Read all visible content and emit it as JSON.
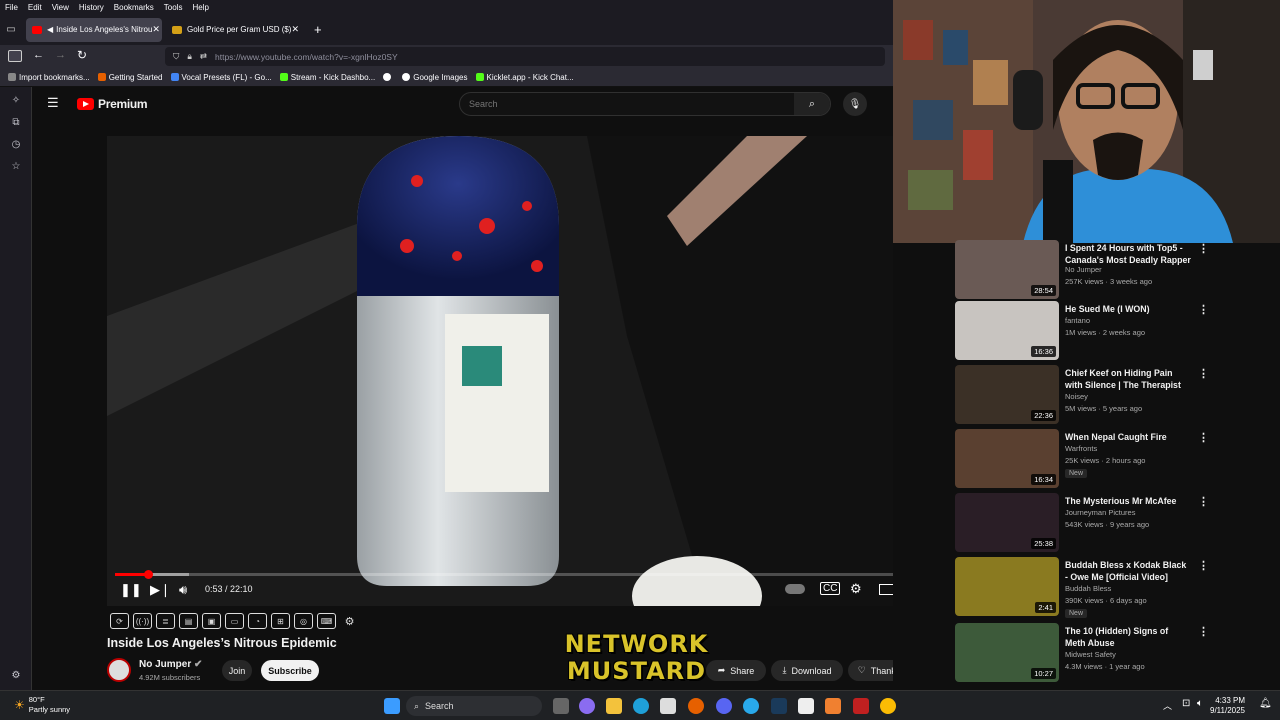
{
  "menu": [
    "File",
    "Edit",
    "View",
    "History",
    "Bookmarks",
    "Tools",
    "Help"
  ],
  "tabs": [
    {
      "label": "Inside Los Angeles's Nitrou",
      "active": true
    },
    {
      "label": "Gold Price per Gram USD ($)",
      "active": false
    }
  ],
  "url": "https://www.youtube.com/watch?v=-xgnlHoz0SY",
  "bookmarks": [
    "Import bookmarks...",
    "Getting Started",
    "Vocal Presets (FL) - Go...",
    "Stream - Kick Dashbo...",
    "",
    "Google Images",
    "Kicklet.app - Kick Chat..."
  ],
  "youtube": {
    "brand": "Premium",
    "search_placeholder": "Search"
  },
  "player": {
    "time": "0:53 / 22:10",
    "progress": 0.04,
    "buffered": 0.09
  },
  "video": {
    "title": "Inside Los Angeles’s Nitrous Epidemic",
    "channel": "No Jumper",
    "subscribers": "4.92M subscribers",
    "join": "Join",
    "subscribe": "Subscribe",
    "share": "Share",
    "download": "Download",
    "thanks": "Thanks"
  },
  "overlay": [
    "NETWORK",
    "MUSTARD"
  ],
  "recommendations": [
    {
      "title": "I Spent 24 Hours with Top5 - Canada's Most Deadly Rapper",
      "channel": "No Jumper",
      "meta": "257K views · 3 weeks ago",
      "duration": "28:54",
      "new": "",
      "color": "#6a5a55"
    },
    {
      "title": "He Sued Me (I WON)",
      "channel": "fantano",
      "meta": "1M views · 2 weeks ago",
      "duration": "16:36",
      "new": "",
      "color": "#c8c4c0"
    },
    {
      "title": "Chief Keef on Hiding Pain with Silence | The Therapist",
      "channel": "Noisey",
      "meta": "5M views · 5 years ago",
      "duration": "22:36",
      "new": "",
      "color": "#3b3026"
    },
    {
      "title": "When Nepal Caught Fire",
      "channel": "Warfronts",
      "meta": "25K views · 2 hours ago",
      "duration": "16:34",
      "new": "New",
      "color": "#5a4030"
    },
    {
      "title": "The Mysterious Mr McAfee",
      "channel": "Journeyman Pictures",
      "meta": "543K views · 9 years ago",
      "duration": "25:38",
      "new": "",
      "color": "#2a1e26"
    },
    {
      "title": "Buddah Bless x Kodak Black - Owe Me [Official Video]",
      "channel": "Buddah Bless",
      "meta": "390K views · 6 days ago",
      "duration": "2:41",
      "new": "New",
      "color": "#8a7a20"
    },
    {
      "title": "The 10 (Hidden) Signs of Meth Abuse",
      "channel": "Midwest Safety",
      "meta": "4.3M views · 1 year ago",
      "duration": "10:27",
      "new": "",
      "color": "#3d5a3a"
    }
  ],
  "taskbar": {
    "temp": "80°F",
    "weather": "Partly sunny",
    "search": "Search",
    "time": "4:33 PM",
    "date": "9/11/2025"
  }
}
